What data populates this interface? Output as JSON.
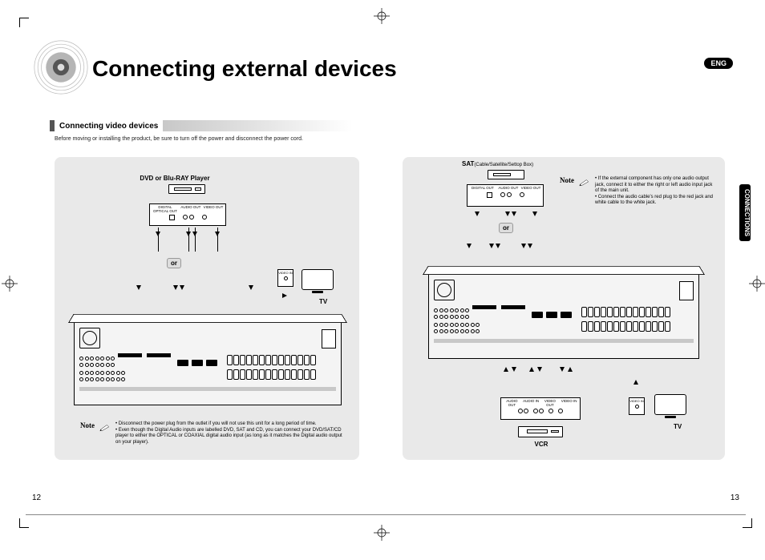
{
  "title": "Connecting external devices",
  "lang_badge": "ENG",
  "side_tab": "CONNECTIONS",
  "section": {
    "heading": "Connecting video devices",
    "subnote": "Before moving or installing the product, be sure to turn off the power and disconnect the power cord."
  },
  "left": {
    "device_label": "DVD or Blu-RAY Player",
    "or": "or",
    "ports": {
      "optical": "DIGITAL\nOPTICAL OUT",
      "audio": "AUDIO\nOUT",
      "video": "VIDEO\nOUT"
    },
    "tv_label": "TV",
    "tv_port": "VIDEO\nIN",
    "note_label": "Note",
    "note_bullets": [
      "Disconnect the power plug from the outlet if you will not use this unit for a long period of time.",
      "Even though the Digital Audio inputs are labelled DVD, SAT and CD, you can connect your DVD/SAT/CD player to either the OPTICAL or COAXIAL digital audio input (as long as it matches the Digital audio output on your player)."
    ]
  },
  "right": {
    "device_label_prefix": "SAT",
    "device_label_suffix": "(Cable/Satellite/Settop Box)",
    "or": "or",
    "sat_ports": {
      "optical": "DIGITAL\nOUT",
      "audio": "AUDIO\nOUT",
      "video": "VIDEO\nOUT"
    },
    "note_label": "Note",
    "note_bullets": [
      "If the external component has only one audio output jack, connect it to either the right or left audio input jack of the main unit.",
      "Connect the audio cable's red plug to the red jack and white cable to the white jack."
    ],
    "vcr_label": "VCR",
    "vcr_ports": {
      "aout": "AUDIO\nOUT",
      "ain": "AUDIO\nIN",
      "vout": "VIDEO\nOUT",
      "vin": "VIDEO\nIN"
    },
    "tv_label": "TV",
    "tv_port": "VIDEO\nIN"
  },
  "page_left": "12",
  "page_right": "13"
}
